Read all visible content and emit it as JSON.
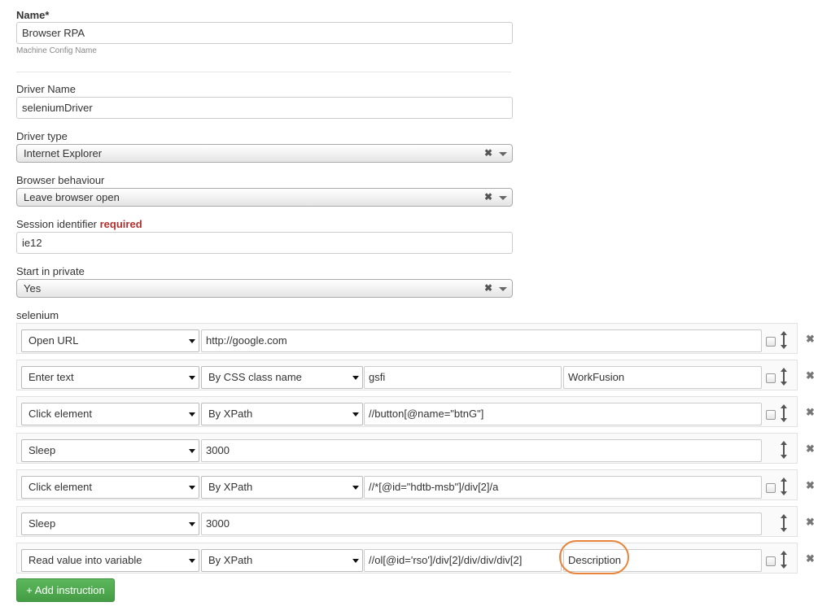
{
  "name_field": {
    "label": "Name*",
    "value": "Browser RPA",
    "help": "Machine Config Name"
  },
  "driver_name": {
    "label": "Driver Name",
    "value": "seleniumDriver"
  },
  "driver_type": {
    "label": "Driver type",
    "value": "Internet Explorer"
  },
  "browser_behaviour": {
    "label": "Browser behaviour",
    "value": "Leave browser open"
  },
  "session_identifier": {
    "label": "Session identifier",
    "required": "required",
    "value": "ie12"
  },
  "start_private": {
    "label": "Start in private",
    "value": "Yes"
  },
  "selenium": {
    "label": "selenium",
    "rows": [
      {
        "action": "Open URL",
        "target": "http://google.com"
      },
      {
        "action": "Enter text",
        "by": "By CSS class name",
        "target": "gsfi",
        "extra": "WorkFusion"
      },
      {
        "action": "Click element",
        "by": "By XPath",
        "target": "//button[@name=\"btnG\"]"
      },
      {
        "action": "Sleep",
        "target": "3000"
      },
      {
        "action": "Click element",
        "by": "By XPath",
        "target": "//*[@id=\"hdtb-msb\"]/div[2]/a"
      },
      {
        "action": "Sleep",
        "target": "3000"
      },
      {
        "action": "Read value into variable",
        "by": "By XPath",
        "target": "//ol[@id='rso']/div[2]/div/div/div[2]",
        "extra": "Description"
      }
    ]
  },
  "add_button": {
    "label": "+ Add instruction"
  },
  "icons": {
    "clear": "clear-x-icon",
    "remove": "remove-x-icon",
    "drag": "drag-handle-icon"
  },
  "colors": {
    "accent_green": "#5cb85c",
    "highlight_orange": "#e8833a",
    "required_red": "#b03030"
  }
}
